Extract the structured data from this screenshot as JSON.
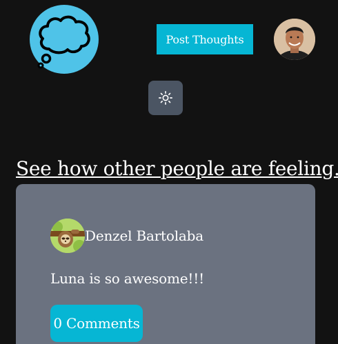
{
  "header": {
    "logo_icon": "thought-cloud-icon",
    "post_button_label": "Post Thoughts",
    "profile_avatar_icon": "user-avatar",
    "theme_toggle_icon": "sun-icon"
  },
  "feed": {
    "heading": "See how other people are feeling...",
    "posts": [
      {
        "author": "Denzel Bartolaba",
        "avatar_icon": "sloth-avatar",
        "text": "Luna is so awesome!!!",
        "comments_label": "0 Comments"
      }
    ]
  },
  "colors": {
    "background": "#121212",
    "accent": "#06b6d4",
    "logo": "#4fc3e8",
    "card": "#6b7280",
    "toggle": "#4b5563"
  }
}
